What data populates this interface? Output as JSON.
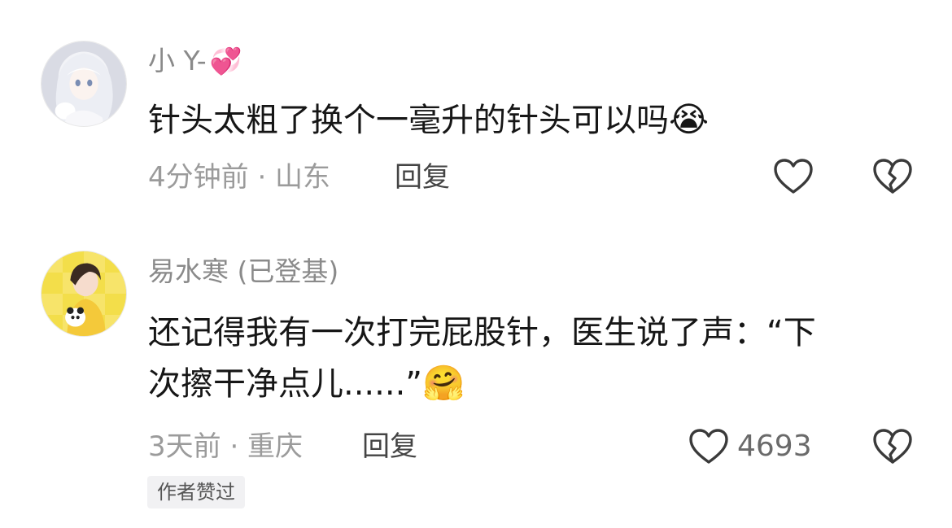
{
  "comments": [
    {
      "username": "小 Y-",
      "username_emoji": "💞",
      "text_lines": [
        "针头太粗了换个一毫升的针头可以吗"
      ],
      "text_emoji": "😭",
      "meta": "4分钟前 · 山东",
      "reply_label": "回复",
      "like_count": "",
      "avatar_style": "white-haired anime girl",
      "colors": {
        "avatar_bg": "#dcdde6",
        "avatar_hair": "#f3f4f8"
      }
    },
    {
      "username": "易水寒 (已登基)",
      "username_emoji": "",
      "text_lines": [
        "还记得我有一次打完屁股针，医生说了声：“下",
        "次擦干净点儿......”"
      ],
      "text_emoji": "🤗",
      "meta": "3天前 · 重庆",
      "reply_label": "回复",
      "like_count": "4693",
      "author_badge": "作者赞过",
      "avatar_style": "anime boy yellow background",
      "colors": {
        "avatar_bg": "#f3de4a",
        "avatar_hair": "#3a2a22"
      }
    }
  ],
  "icons": {
    "like": "heart-outline-icon",
    "dislike": "broken-heart-outline-icon"
  },
  "colors": {
    "username": "#8a8a8a",
    "text": "#161616",
    "meta": "#9b9b9b",
    "icon": "#3a3a3a"
  }
}
